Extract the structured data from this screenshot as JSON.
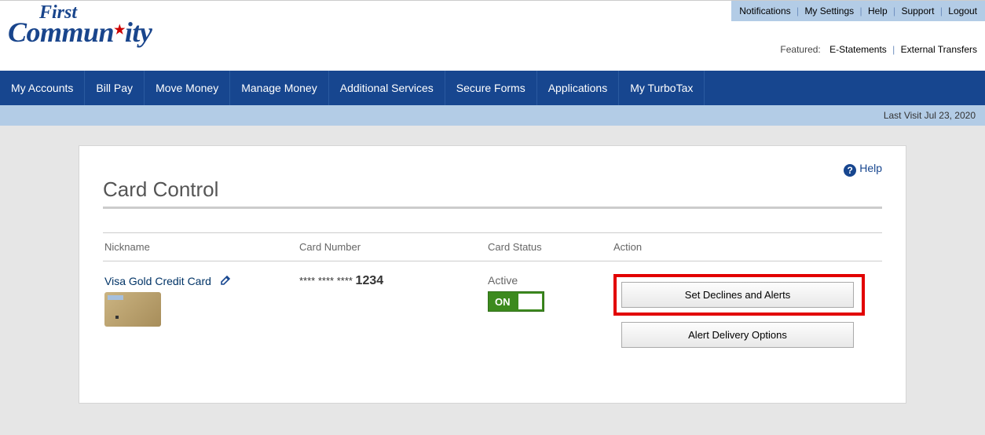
{
  "topLinks": {
    "notifications": "Notifications",
    "mySettings": "My Settings",
    "help": "Help",
    "support": "Support",
    "logout": "Logout"
  },
  "featured": {
    "label": "Featured:",
    "eStatements": "E-Statements",
    "externalTransfers": "External Transfers"
  },
  "nav": {
    "items": [
      "My Accounts",
      "Bill Pay",
      "Move Money",
      "Manage Money",
      "Additional Services",
      "Secure Forms",
      "Applications",
      "My TurboTax"
    ]
  },
  "subbar": {
    "lastVisit": "Last Visit Jul 23, 2020"
  },
  "page": {
    "helpLabel": "Help",
    "title": "Card Control",
    "columns": {
      "nickname": "Nickname",
      "cardNumber": "Card Number",
      "cardStatus": "Card Status",
      "action": "Action"
    },
    "card": {
      "nickname": "Visa Gold Credit Card",
      "maskedPrefix": "**** **** **** ",
      "last4": "1234",
      "status": "Active",
      "toggleLabel": "ON",
      "btnDeclines": "Set Declines and Alerts",
      "btnDelivery": "Alert Delivery Options"
    }
  }
}
